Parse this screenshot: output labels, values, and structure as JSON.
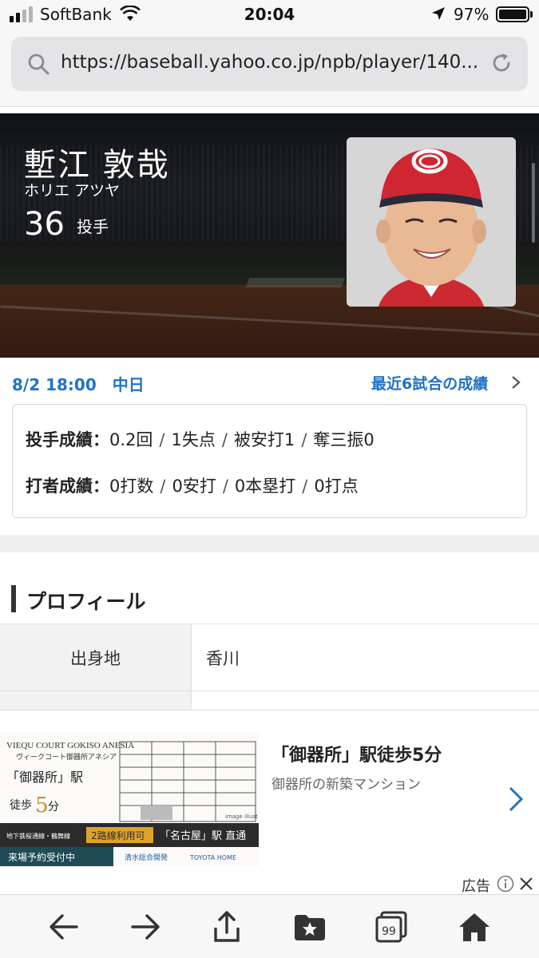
{
  "status_bar": {
    "carrier": "SoftBank",
    "time": "20:04",
    "battery": "97%"
  },
  "browser": {
    "url": "https://baseball.yahoo.co.jp/npb/player/140..."
  },
  "player": {
    "name": "塹江 敦哉",
    "kana": "ホリエ アツヤ",
    "number": "36",
    "position": "投手"
  },
  "recent_game": {
    "date": "8/2 18:00　中日",
    "recent_link": "最近6試合の成績",
    "pitching": {
      "label": "投手成績：",
      "values": [
        "0.2回",
        "1失点",
        "被安打1",
        "奪三振0"
      ]
    },
    "batting": {
      "label": "打者成績：",
      "values": [
        "0打数",
        "0安打",
        "0本塁打",
        "0打点"
      ]
    }
  },
  "profile": {
    "title": "プロフィール",
    "rows": [
      {
        "label": "出身地",
        "value": "香川"
      }
    ]
  },
  "ad": {
    "title": "「御器所」駅徒歩5分",
    "subtitle": "御器所の新築マンション",
    "label": "広告",
    "image": {
      "brand": "VIEQU COURT GOKISO ANESIA",
      "brand_kana": "ヴィークコート御器所アネシア",
      "station": "「御器所」駅",
      "walk": "徒歩",
      "walk_min": "5",
      "walk_unit": "分",
      "lines": "地下鉄桜通線・鶴舞線",
      "lines_badge": "2路線利用可",
      "direct": "「名古屋」駅 直通",
      "reservation": "来場予約受付中",
      "image_note": "image illust",
      "sponsor1": "清水総合開発",
      "sponsor2": "TOYOTA HOME"
    }
  },
  "toolbar": {
    "tabs_count": "99"
  },
  "colors": {
    "link_blue": "#1f73c7",
    "accent_orange": "#e0a32a",
    "ad_dark": "#2b2b2b"
  }
}
